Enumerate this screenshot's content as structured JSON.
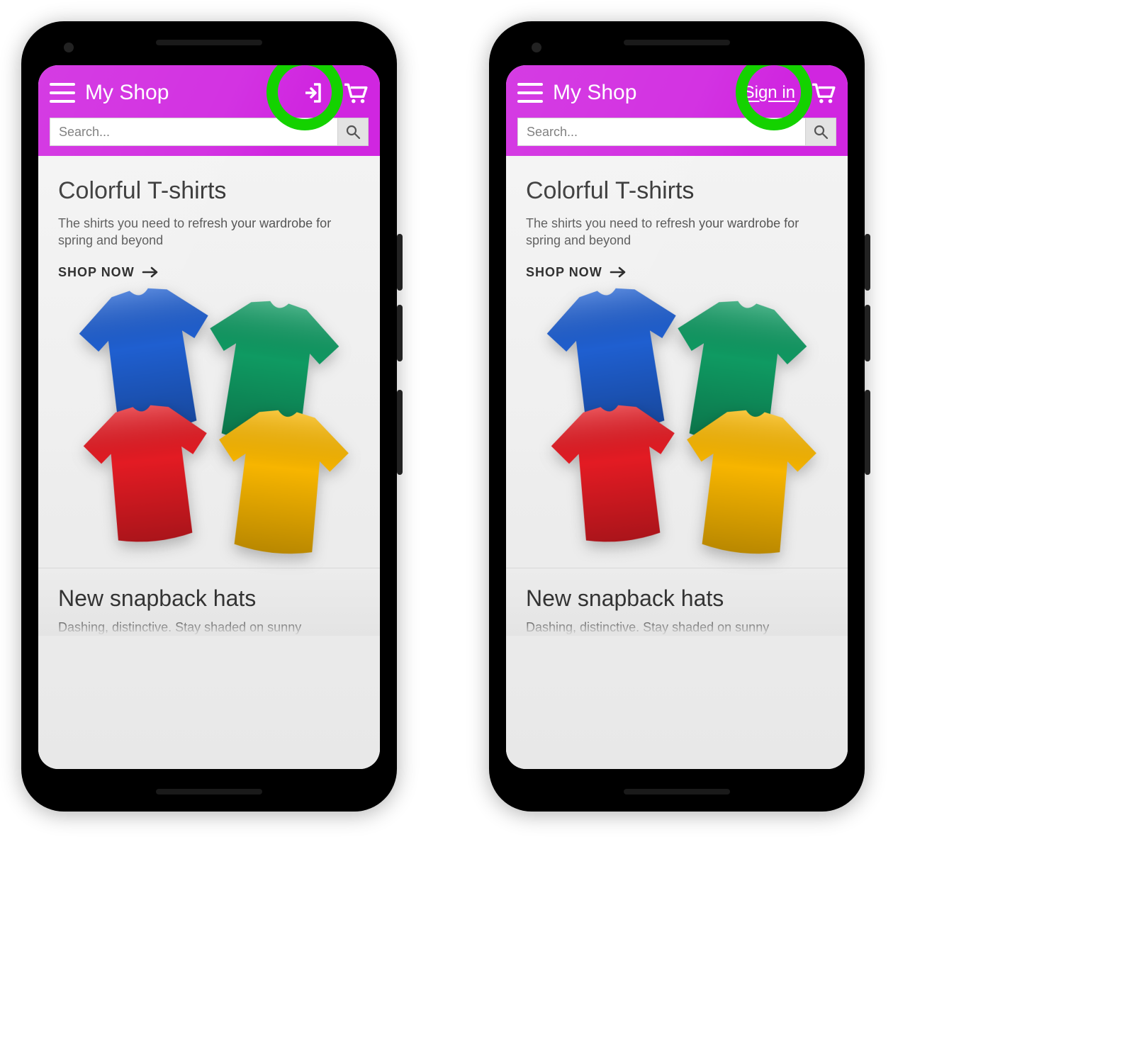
{
  "header": {
    "title": "My Shop",
    "signin_label": "Sign in",
    "search_placeholder": "Search..."
  },
  "hero": {
    "title": "Colorful T-shirts",
    "subtitle": "The shirts you need to refresh your wardrobe for spring and beyond",
    "cta": "SHOP NOW"
  },
  "section2": {
    "title": "New snapback hats",
    "subtitle_partial": "Dashing, distinctive. Stay shaded on sunny"
  },
  "colors": {
    "accent": "#d026e0",
    "highlight": "#14d200",
    "tshirt_blue": "#1f5fd0",
    "tshirt_green": "#0f9a62",
    "tshirt_red": "#e31b23",
    "tshirt_yellow": "#f7b500"
  }
}
